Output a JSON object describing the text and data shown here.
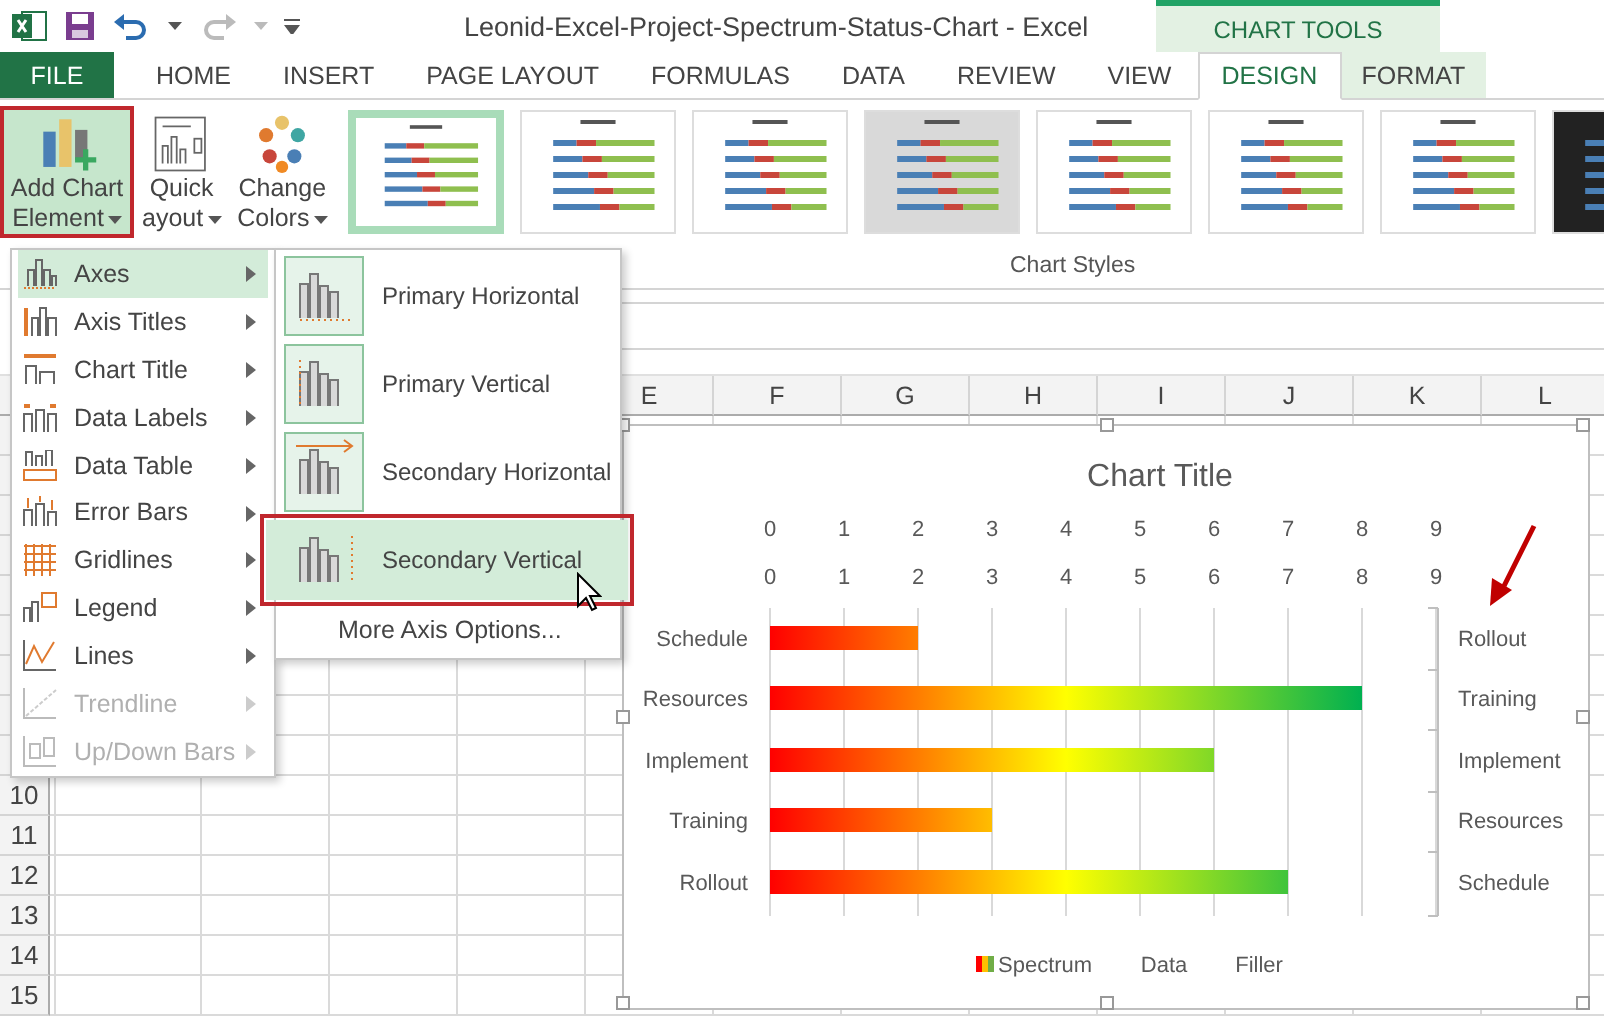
{
  "title_bar": {
    "title": "Leonid-Excel-Project-Spectrum-Status-Chart - Excel",
    "context_header": "CHART TOOLS"
  },
  "tabs": [
    {
      "label": "FILE",
      "kind": "file",
      "selected": false
    },
    {
      "label": "HOME",
      "kind": "plain",
      "selected": false
    },
    {
      "label": "INSERT",
      "kind": "plain",
      "selected": false
    },
    {
      "label": "PAGE LAYOUT",
      "kind": "plain",
      "selected": false
    },
    {
      "label": "FORMULAS",
      "kind": "plain",
      "selected": false
    },
    {
      "label": "DATA",
      "kind": "plain",
      "selected": false
    },
    {
      "label": "REVIEW",
      "kind": "plain",
      "selected": false
    },
    {
      "label": "VIEW",
      "kind": "plain",
      "selected": false
    },
    {
      "label": "DESIGN",
      "kind": "context",
      "selected": true
    },
    {
      "label": "FORMAT",
      "kind": "context",
      "selected": false
    }
  ],
  "ribbon": {
    "buttons": [
      {
        "lines": [
          "Add Chart",
          "Element"
        ],
        "pressed": true
      },
      {
        "lines": [
          "Quick",
          "ayout"
        ],
        "pressed": false
      },
      {
        "lines": [
          "Change",
          "Colors"
        ],
        "pressed": false
      }
    ],
    "chart_styles": [
      {
        "kind": "light",
        "selected": true
      },
      {
        "kind": "light",
        "selected": false
      },
      {
        "kind": "light",
        "selected": false
      },
      {
        "kind": "gray",
        "selected": false
      },
      {
        "kind": "light",
        "selected": false
      },
      {
        "kind": "light",
        "selected": false
      },
      {
        "kind": "light",
        "selected": false
      },
      {
        "kind": "dark",
        "selected": false
      }
    ],
    "group_label": "Chart Styles"
  },
  "sheet": {
    "columns": [
      "E",
      "F",
      "G",
      "H",
      "I",
      "J",
      "K",
      "L"
    ],
    "rows": [
      "10",
      "11",
      "12",
      "13",
      "14",
      "15"
    ]
  },
  "chart": {
    "other_legend_entries": [
      "Data",
      "Filler"
    ],
    "secondary_ticks": [
      "0",
      "1",
      "2",
      "3",
      "4",
      "5",
      "6",
      "7",
      "8",
      "9"
    ],
    "secondary_labels": [
      "Rollout",
      "Training",
      "Implement",
      "Resources",
      "Schedule"
    ],
    "chart_data": {
      "type": "bar",
      "orientation": "horizontal",
      "title": "Chart Title",
      "categories": [
        "Schedule",
        "Resources",
        "Implement",
        "Training",
        "Rollout"
      ],
      "series": [
        {
          "name": "Spectrum",
          "values": [
            2,
            8,
            6,
            3,
            7
          ]
        }
      ],
      "xlim": [
        0,
        9
      ],
      "grid": true,
      "xticks": [
        {
          "value": 0,
          "label": "0"
        },
        {
          "value": 1,
          "label": "1"
        },
        {
          "value": 2,
          "label": "2"
        },
        {
          "value": 3,
          "label": "3"
        },
        {
          "value": 4,
          "label": "4"
        },
        {
          "value": 5,
          "label": "5"
        },
        {
          "value": 6,
          "label": "6"
        },
        {
          "value": 7,
          "label": "7"
        },
        {
          "value": 8,
          "label": "8"
        },
        {
          "value": 9,
          "label": "9"
        }
      ]
    }
  },
  "menu": {
    "items": [
      {
        "label": "Axes",
        "selected": true,
        "disabled": false
      },
      {
        "label": "Axis Titles",
        "selected": false,
        "disabled": false
      },
      {
        "label": "Chart Title",
        "selected": false,
        "disabled": false
      },
      {
        "label": "Data Labels",
        "selected": false,
        "disabled": false
      },
      {
        "label": "Data Table",
        "selected": false,
        "disabled": false
      },
      {
        "label": "Error Bars",
        "selected": false,
        "disabled": false
      },
      {
        "label": "Gridlines",
        "selected": false,
        "disabled": false
      },
      {
        "label": "Legend",
        "selected": false,
        "disabled": false
      },
      {
        "label": "Lines",
        "selected": false,
        "disabled": false
      },
      {
        "label": "Trendline",
        "selected": false,
        "disabled": true
      },
      {
        "label": "Up/Down Bars",
        "selected": false,
        "disabled": true
      }
    ]
  },
  "submenu": {
    "items": [
      {
        "label": "Primary Horizontal",
        "selected": false
      },
      {
        "label": "Primary Vertical",
        "selected": false
      },
      {
        "label": "Secondary Horizontal",
        "selected": false
      },
      {
        "label": "Secondary Vertical",
        "selected": true
      }
    ],
    "more_options": "More Axis Options..."
  }
}
